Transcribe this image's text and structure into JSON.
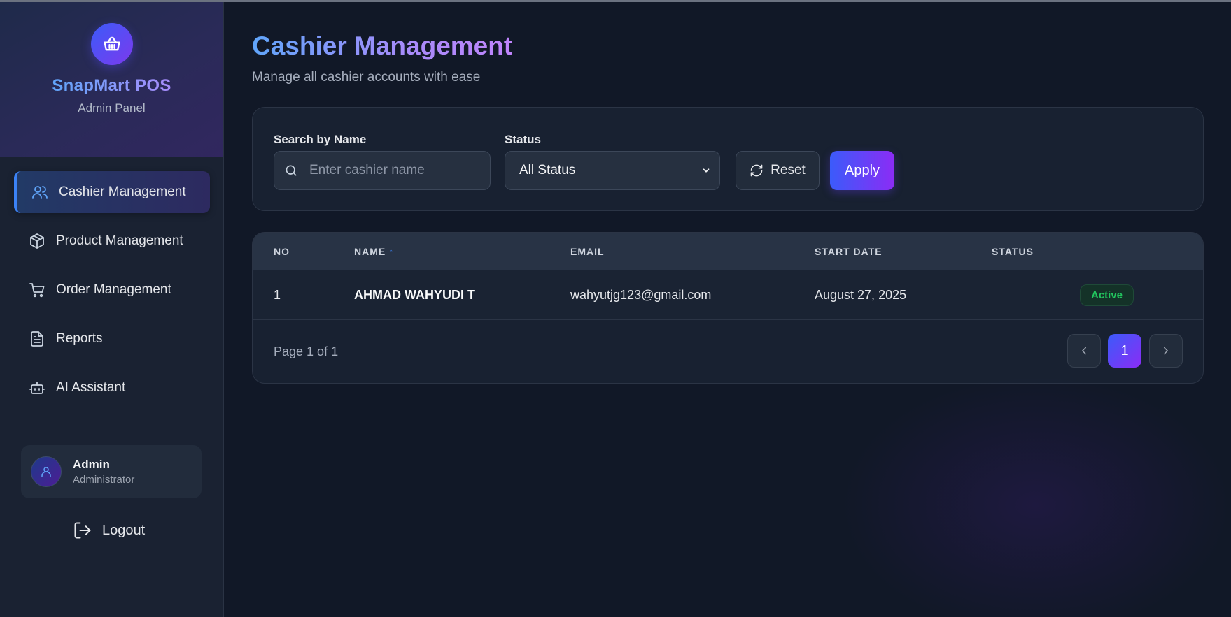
{
  "brand": {
    "name": "SnapMart POS",
    "subtitle": "Admin Panel",
    "icon": "basket-icon"
  },
  "nav": [
    {
      "label": "Cashier Management",
      "icon": "users-icon",
      "active": true
    },
    {
      "label": "Product Management",
      "icon": "box-icon",
      "active": false
    },
    {
      "label": "Order Management",
      "icon": "cart-icon",
      "active": false
    },
    {
      "label": "Reports",
      "icon": "file-text-icon",
      "active": false
    },
    {
      "label": "AI Assistant",
      "icon": "bot-icon",
      "active": false
    }
  ],
  "user": {
    "name": "Admin",
    "role": "Administrator",
    "icon": "user-icon"
  },
  "logout": {
    "label": "Logout",
    "icon": "logout-icon"
  },
  "page": {
    "title": "Cashier Management",
    "subtitle": "Manage all cashier accounts with ease"
  },
  "filters": {
    "search_label": "Search by Name",
    "search_placeholder": "Enter cashier name",
    "search_value": "",
    "status_label": "Status",
    "status_value": "All Status",
    "reset_label": "Reset",
    "apply_label": "Apply"
  },
  "table": {
    "columns": {
      "no": "NO",
      "name": "NAME",
      "name_sort": "↑",
      "email": "EMAIL",
      "start_date": "START DATE",
      "status": "STATUS"
    },
    "rows": [
      {
        "no": "1",
        "name": "AHMAD WAHYUDI T",
        "email": "wahyutjg123@gmail.com",
        "start_date": "August 27, 2025",
        "status": "Active"
      }
    ]
  },
  "pagination": {
    "text": "Page 1 of 1",
    "current": "1"
  },
  "colors": {
    "accent_blue": "#3b82f6",
    "accent_purple": "#8b2cf5",
    "status_active": "#22c55e",
    "background": "#111827"
  }
}
